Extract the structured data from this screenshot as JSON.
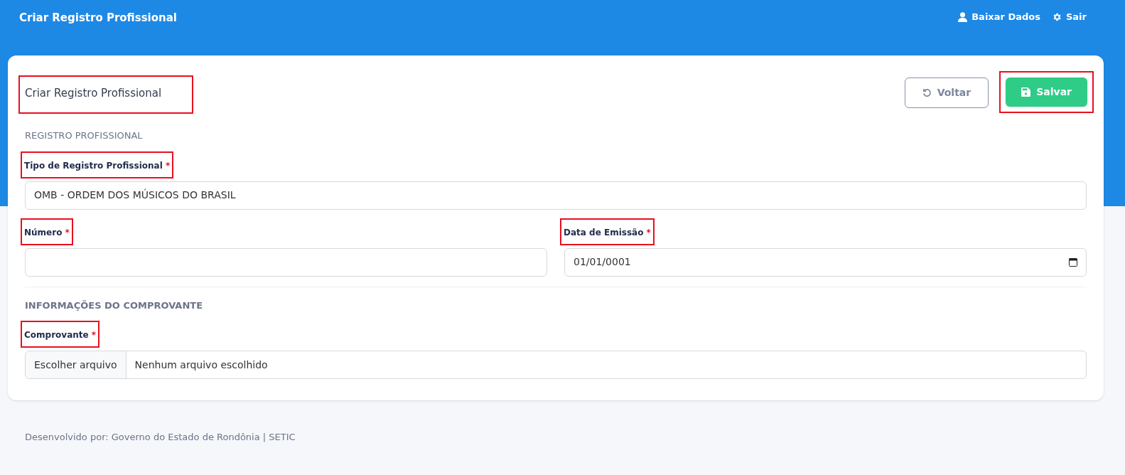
{
  "topbar": {
    "title": "Criar Registro Profissional",
    "actions": [
      {
        "kind": "user",
        "label": "Baixar Dados"
      },
      {
        "kind": "gear",
        "label": "Sair"
      }
    ]
  },
  "card": {
    "title": "Criar Registro Profissional",
    "title_highlighted": true,
    "buttons": [
      {
        "kind": "back",
        "label": "Voltar",
        "highlighted": false
      },
      {
        "kind": "save",
        "label": "Salvar",
        "highlighted": true
      }
    ],
    "sections": [
      {
        "heading": "REGISTRO PROFISSIONAL",
        "bold": false,
        "rows": [
          [
            {
              "kind": "select",
              "label": "Tipo de Registro Profissional",
              "mark": "*",
              "highlighted": true,
              "value": "OMB - ORDEM DOS MÚSICOS DO BRASIL"
            }
          ],
          [
            {
              "kind": "text",
              "label": "Número",
              "mark": "*",
              "highlighted": true
            },
            {
              "kind": "date",
              "label": "Data de Emissão",
              "mark": "*",
              "highlighted": true,
              "value": "01/01/0001"
            }
          ]
        ]
      },
      {
        "heading": "INFORMAÇÕES DO COMPROVANTE",
        "bold": true,
        "rows": [
          [
            {
              "kind": "file",
              "label": "Comprovante",
              "mark": "*",
              "highlighted": true,
              "button": "Escolher arquivo",
              "value": "Nenhum arquivo escolhido"
            }
          ]
        ]
      }
    ]
  },
  "footer": "Desenvolvido por: Governo do Estado de Rondônia | SETIC"
}
